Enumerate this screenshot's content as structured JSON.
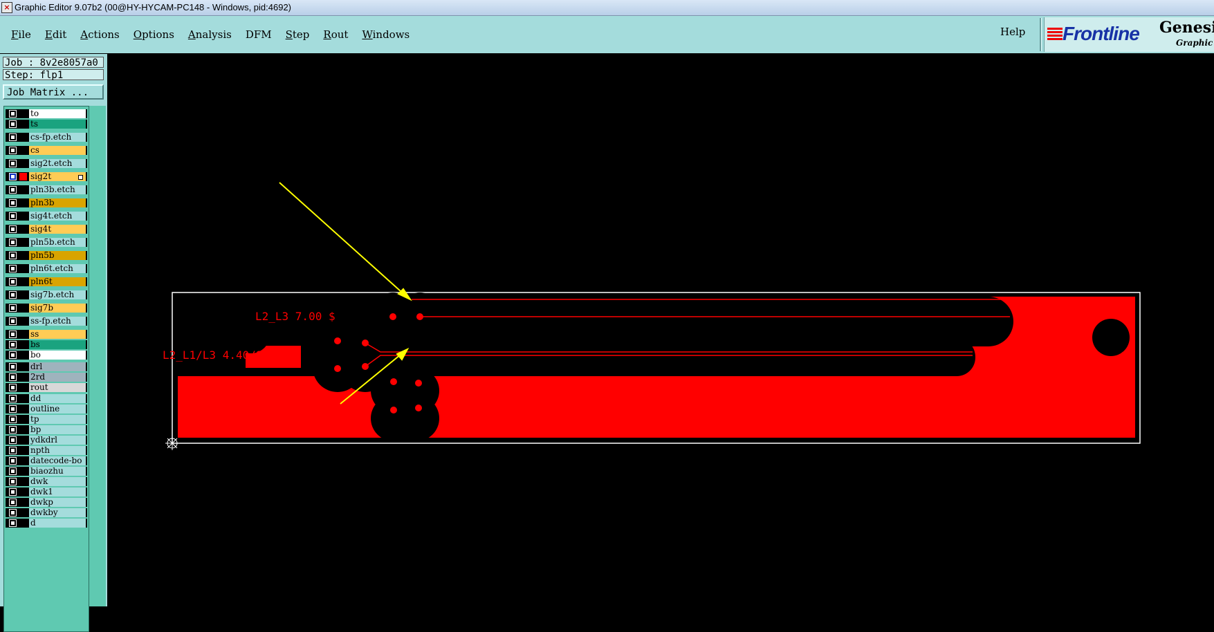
{
  "window": {
    "title": "Graphic Editor 9.07b2 (00@HY-HYCAM-PC148 - Windows, pid:4692)"
  },
  "menu": {
    "items": [
      {
        "label": "File",
        "u": "F",
        "rest": "ile"
      },
      {
        "label": "Edit",
        "u": "E",
        "rest": "dit"
      },
      {
        "label": "Actions",
        "u": "A",
        "rest": "ctions"
      },
      {
        "label": "Options",
        "u": "O",
        "rest": "ptions"
      },
      {
        "label": "Analysis",
        "u": "A",
        "rest": "nalysis"
      },
      {
        "label": "DFM",
        "u": "",
        "rest": "DFM"
      },
      {
        "label": "Step",
        "u": "S",
        "rest": "tep"
      },
      {
        "label": "Rout",
        "u": "R",
        "rest": "out"
      },
      {
        "label": "Windows",
        "u": "W",
        "rest": "indows"
      }
    ],
    "help": "Help"
  },
  "logo": {
    "brand": "Frontline",
    "product": "Genesis",
    "subtitle": "Graphic E"
  },
  "job": {
    "job_line": "Job : 8v2e8057a0",
    "step_line": "Step: flp1",
    "matrix_button": "Job Matrix ..."
  },
  "layers": [
    {
      "name": "to",
      "color": "#ffffff"
    },
    {
      "name": "ts",
      "color": "#1aa37f"
    },
    {
      "name": "cs-fp.etch",
      "color": "#a4dcdc"
    },
    {
      "name": "cs",
      "color": "#ffcc55"
    },
    {
      "name": "sig2t.etch",
      "color": "#a4dcdc"
    },
    {
      "name": "sig2t",
      "color": "#ffcc55",
      "active": true
    },
    {
      "name": "pln3b.etch",
      "color": "#a4dcdc"
    },
    {
      "name": "pln3b",
      "color": "#d9a400"
    },
    {
      "name": "sig4t.etch",
      "color": "#a4dcdc"
    },
    {
      "name": "sig4t",
      "color": "#ffcc55"
    },
    {
      "name": "pln5b.etch",
      "color": "#a4dcdc"
    },
    {
      "name": "pln5b",
      "color": "#d9a400"
    },
    {
      "name": "pln6t.etch",
      "color": "#a4dcdc"
    },
    {
      "name": "pln6t",
      "color": "#d9a400"
    },
    {
      "name": "sig7b.etch",
      "color": "#a4dcdc"
    },
    {
      "name": "sig7b",
      "color": "#ffcc55"
    },
    {
      "name": "ss-fp.etch",
      "color": "#a4dcdc"
    },
    {
      "name": "ss",
      "color": "#ffcc55"
    },
    {
      "name": "bs",
      "color": "#1aa37f"
    },
    {
      "name": "bo",
      "color": "#ffffff"
    },
    {
      "name": "drl",
      "color": "#9fb3bd"
    },
    {
      "name": "2rd",
      "color": "#9fb3bd"
    },
    {
      "name": "rout",
      "color": "#d8d8d8"
    },
    {
      "name": "dd",
      "color": "#a4dcdc"
    },
    {
      "name": "outline",
      "color": "#a4dcdc"
    },
    {
      "name": "tp",
      "color": "#a4dcdc"
    },
    {
      "name": "bp",
      "color": "#a4dcdc"
    },
    {
      "name": "ydkdrl",
      "color": "#a4dcdc"
    },
    {
      "name": "npth",
      "color": "#a4dcdc"
    },
    {
      "name": "datecode-bo",
      "color": "#a4dcdc"
    },
    {
      "name": "biaozhu",
      "color": "#a4dcdc"
    },
    {
      "name": "dwk",
      "color": "#a4dcdc"
    },
    {
      "name": "dwk1",
      "color": "#a4dcdc"
    },
    {
      "name": "dwkp",
      "color": "#a4dcdc"
    },
    {
      "name": "dwkby",
      "color": "#a4dcdc"
    },
    {
      "name": "d",
      "color": "#a4dcdc"
    }
  ],
  "canvas": {
    "label_top": "L2_L3 7.00 $",
    "label_bottom": "L2_L1/L3 4.40/9.77 $",
    "copper_color": "#ff0000",
    "arrow_color": "#ffff00"
  }
}
